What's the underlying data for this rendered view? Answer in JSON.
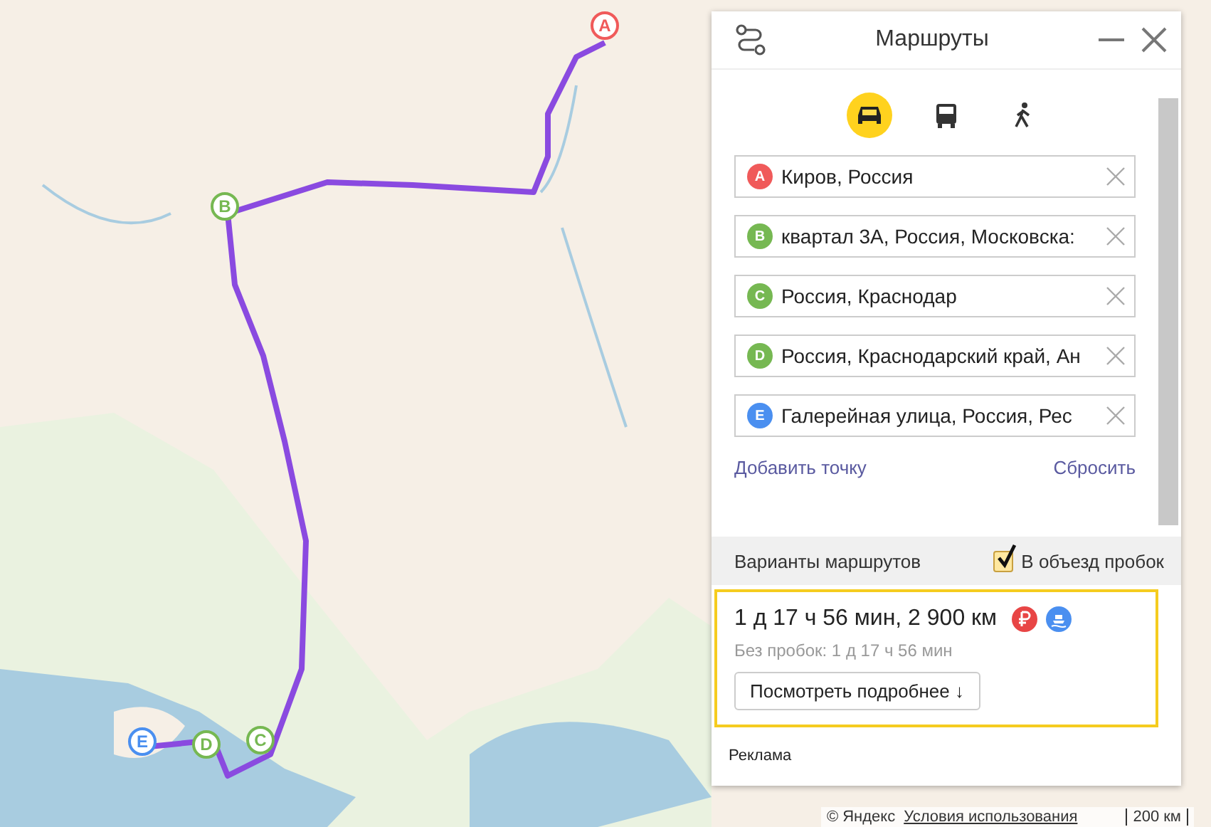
{
  "map": {
    "pins": [
      {
        "label": "A",
        "color": "#f05a5a"
      },
      {
        "label": "B",
        "color": "#76b852"
      },
      {
        "label": "E",
        "color": "#4a8ff0"
      },
      {
        "label": "D",
        "color": "#76b852"
      },
      {
        "label": "C",
        "color": "#76b852"
      }
    ],
    "copyright": "© Яндекс",
    "terms_link": "Условия использования",
    "scale": "200 км"
  },
  "panel": {
    "title": "Маршруты",
    "modes": [
      {
        "kind": "car",
        "selected": true
      },
      {
        "kind": "bus",
        "selected": false
      },
      {
        "kind": "walk",
        "selected": false
      }
    ],
    "points": [
      {
        "letter": "A",
        "color": "#f05a5a",
        "value": "Киров, Россия"
      },
      {
        "letter": "B",
        "color": "#76b852",
        "value": "квартал 3А, Россия, Московска:"
      },
      {
        "letter": "C",
        "color": "#76b852",
        "value": "Россия, Краснодар"
      },
      {
        "letter": "D",
        "color": "#76b852",
        "value": "Россия, Краснодарский край, Ан"
      },
      {
        "letter": "E",
        "color": "#4a8ff0",
        "value": "Галерейная улица, Россия, Рес"
      }
    ],
    "add_point": "Добавить точку",
    "reset": "Сбросить",
    "variants_label": "Варианты маршрутов",
    "avoid_traffic": {
      "label": "В объезд пробок",
      "checked": true
    },
    "route": {
      "summary": "1 д 17 ч 56 мин, 2 900 км",
      "no_traffic": "Без пробок: 1 д 17 ч 56 мин",
      "details_button": "Посмотреть подробнее ↓",
      "selected": true
    },
    "ad_label": "Реклама"
  }
}
